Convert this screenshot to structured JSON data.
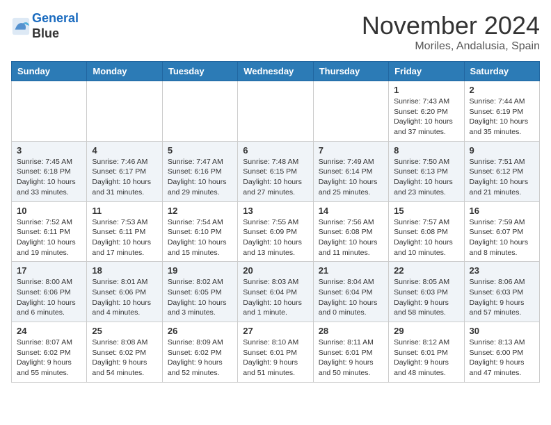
{
  "header": {
    "logo_line1": "General",
    "logo_line2": "Blue",
    "month": "November 2024",
    "location": "Moriles, Andalusia, Spain"
  },
  "weekdays": [
    "Sunday",
    "Monday",
    "Tuesday",
    "Wednesday",
    "Thursday",
    "Friday",
    "Saturday"
  ],
  "weeks": [
    [
      {
        "day": "",
        "info": ""
      },
      {
        "day": "",
        "info": ""
      },
      {
        "day": "",
        "info": ""
      },
      {
        "day": "",
        "info": ""
      },
      {
        "day": "",
        "info": ""
      },
      {
        "day": "1",
        "info": "Sunrise: 7:43 AM\nSunset: 6:20 PM\nDaylight: 10 hours and 37 minutes."
      },
      {
        "day": "2",
        "info": "Sunrise: 7:44 AM\nSunset: 6:19 PM\nDaylight: 10 hours and 35 minutes."
      }
    ],
    [
      {
        "day": "3",
        "info": "Sunrise: 7:45 AM\nSunset: 6:18 PM\nDaylight: 10 hours and 33 minutes."
      },
      {
        "day": "4",
        "info": "Sunrise: 7:46 AM\nSunset: 6:17 PM\nDaylight: 10 hours and 31 minutes."
      },
      {
        "day": "5",
        "info": "Sunrise: 7:47 AM\nSunset: 6:16 PM\nDaylight: 10 hours and 29 minutes."
      },
      {
        "day": "6",
        "info": "Sunrise: 7:48 AM\nSunset: 6:15 PM\nDaylight: 10 hours and 27 minutes."
      },
      {
        "day": "7",
        "info": "Sunrise: 7:49 AM\nSunset: 6:14 PM\nDaylight: 10 hours and 25 minutes."
      },
      {
        "day": "8",
        "info": "Sunrise: 7:50 AM\nSunset: 6:13 PM\nDaylight: 10 hours and 23 minutes."
      },
      {
        "day": "9",
        "info": "Sunrise: 7:51 AM\nSunset: 6:12 PM\nDaylight: 10 hours and 21 minutes."
      }
    ],
    [
      {
        "day": "10",
        "info": "Sunrise: 7:52 AM\nSunset: 6:11 PM\nDaylight: 10 hours and 19 minutes."
      },
      {
        "day": "11",
        "info": "Sunrise: 7:53 AM\nSunset: 6:11 PM\nDaylight: 10 hours and 17 minutes."
      },
      {
        "day": "12",
        "info": "Sunrise: 7:54 AM\nSunset: 6:10 PM\nDaylight: 10 hours and 15 minutes."
      },
      {
        "day": "13",
        "info": "Sunrise: 7:55 AM\nSunset: 6:09 PM\nDaylight: 10 hours and 13 minutes."
      },
      {
        "day": "14",
        "info": "Sunrise: 7:56 AM\nSunset: 6:08 PM\nDaylight: 10 hours and 11 minutes."
      },
      {
        "day": "15",
        "info": "Sunrise: 7:57 AM\nSunset: 6:08 PM\nDaylight: 10 hours and 10 minutes."
      },
      {
        "day": "16",
        "info": "Sunrise: 7:59 AM\nSunset: 6:07 PM\nDaylight: 10 hours and 8 minutes."
      }
    ],
    [
      {
        "day": "17",
        "info": "Sunrise: 8:00 AM\nSunset: 6:06 PM\nDaylight: 10 hours and 6 minutes."
      },
      {
        "day": "18",
        "info": "Sunrise: 8:01 AM\nSunset: 6:06 PM\nDaylight: 10 hours and 4 minutes."
      },
      {
        "day": "19",
        "info": "Sunrise: 8:02 AM\nSunset: 6:05 PM\nDaylight: 10 hours and 3 minutes."
      },
      {
        "day": "20",
        "info": "Sunrise: 8:03 AM\nSunset: 6:04 PM\nDaylight: 10 hours and 1 minute."
      },
      {
        "day": "21",
        "info": "Sunrise: 8:04 AM\nSunset: 6:04 PM\nDaylight: 10 hours and 0 minutes."
      },
      {
        "day": "22",
        "info": "Sunrise: 8:05 AM\nSunset: 6:03 PM\nDaylight: 9 hours and 58 minutes."
      },
      {
        "day": "23",
        "info": "Sunrise: 8:06 AM\nSunset: 6:03 PM\nDaylight: 9 hours and 57 minutes."
      }
    ],
    [
      {
        "day": "24",
        "info": "Sunrise: 8:07 AM\nSunset: 6:02 PM\nDaylight: 9 hours and 55 minutes."
      },
      {
        "day": "25",
        "info": "Sunrise: 8:08 AM\nSunset: 6:02 PM\nDaylight: 9 hours and 54 minutes."
      },
      {
        "day": "26",
        "info": "Sunrise: 8:09 AM\nSunset: 6:02 PM\nDaylight: 9 hours and 52 minutes."
      },
      {
        "day": "27",
        "info": "Sunrise: 8:10 AM\nSunset: 6:01 PM\nDaylight: 9 hours and 51 minutes."
      },
      {
        "day": "28",
        "info": "Sunrise: 8:11 AM\nSunset: 6:01 PM\nDaylight: 9 hours and 50 minutes."
      },
      {
        "day": "29",
        "info": "Sunrise: 8:12 AM\nSunset: 6:01 PM\nDaylight: 9 hours and 48 minutes."
      },
      {
        "day": "30",
        "info": "Sunrise: 8:13 AM\nSunset: 6:00 PM\nDaylight: 9 hours and 47 minutes."
      }
    ]
  ]
}
